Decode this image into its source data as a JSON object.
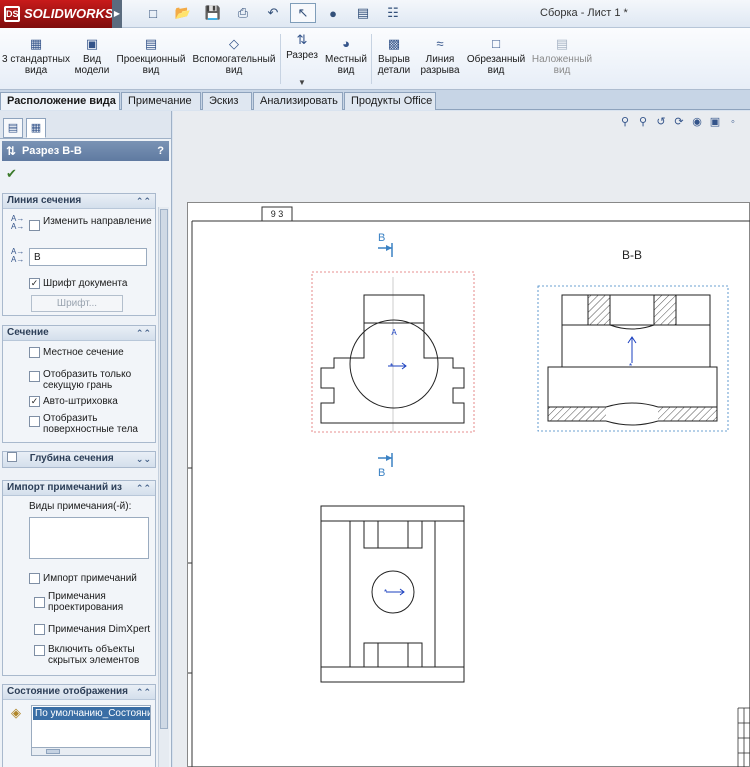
{
  "app": {
    "name": "SOLIDWORKS",
    "document_title": "Сборка - Лист 1 *"
  },
  "quick_access": {
    "icons": [
      "new-file-icon",
      "open-folder-icon",
      "save-icon",
      "print-icon",
      "undo-icon",
      "select-pointer-icon",
      "traffic-light-icon",
      "file-properties-icon",
      "options-icon"
    ]
  },
  "ribbon": {
    "buttons": [
      {
        "id": "standard-3views",
        "label": "3 стандартных вида",
        "disabled": false
      },
      {
        "id": "model-view",
        "label": "Вид модели",
        "disabled": false
      },
      {
        "id": "projected-view",
        "label": "Проекционный вид",
        "disabled": false
      },
      {
        "id": "auxiliary-view",
        "label": "Вспомогательный вид",
        "disabled": false
      },
      {
        "id": "section-view",
        "label": "Разрез",
        "disabled": false
      },
      {
        "id": "detail-view",
        "label": "Местный вид",
        "disabled": false
      },
      {
        "id": "broken-out-section",
        "label": "Вырыв детали",
        "disabled": false
      },
      {
        "id": "break-line",
        "label": "Линия разрыва",
        "disabled": false
      },
      {
        "id": "crop-view",
        "label": "Обрезанный вид",
        "disabled": false
      },
      {
        "id": "alternate-position",
        "label": "Наложенный вид",
        "disabled": true
      }
    ]
  },
  "tabs": [
    {
      "label": "Расположение вида",
      "active": true
    },
    {
      "label": "Примечание",
      "active": false
    },
    {
      "label": "Эскиз",
      "active": false
    },
    {
      "label": "Анализировать",
      "active": false
    },
    {
      "label": "Продукты Office",
      "active": false
    }
  ],
  "property_manager": {
    "title": "Разрез B-B",
    "help": "?",
    "groups": {
      "section_line": {
        "title": "Линия сечения",
        "flip_direction": {
          "label": "Изменить направление",
          "checked": false
        },
        "label_value": "B",
        "document_font": {
          "label": "Шрифт документа",
          "checked": true
        },
        "font_button": "Шрифт..."
      },
      "section": {
        "title": "Сечение",
        "partial_section": {
          "label": "Местное сечение",
          "checked": false
        },
        "display_surface_only": {
          "label": "Отобразить только секущую грань",
          "checked": false
        },
        "auto_hatching": {
          "label": "Авто-штриховка",
          "checked": true
        },
        "display_surface_bodies": {
          "label": "Отобразить поверхностные тела",
          "checked": false
        }
      },
      "section_depth": {
        "title": "Глубина сечения",
        "checked": false
      },
      "import_annotations": {
        "title": "Импорт примечаний из",
        "annotation_views_label": "Виды примечания(-й):",
        "import_annotations": {
          "label": "Импорт примечаний",
          "checked": false
        },
        "design_annotations": {
          "label": "Примечания проектирования",
          "checked": false
        },
        "dimxpert_annotations": {
          "label": "Примечания DimXpert",
          "checked": false
        },
        "include_hidden": {
          "label": "Включить объекты скрытых элементов",
          "checked": false
        }
      },
      "display_state": {
        "title": "Состояние отображения",
        "selected": "По умолчанию_Состояние"
      }
    }
  },
  "drawing": {
    "zone_label": "9 3",
    "section_label_top": "B",
    "section_label_bottom": "B",
    "section_view_title": "B-B"
  }
}
